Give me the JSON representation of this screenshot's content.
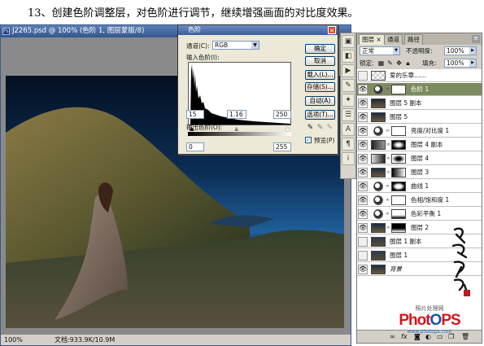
{
  "caption": "13、创建色阶调整层，对色阶进行调节，继续增强画面的对比度效果。",
  "document": {
    "title": "J2265.psd @ 100% (色阶 1, 图层蒙版/8)",
    "zoom": "100%",
    "file_info": "文档:933.9K/10.9M"
  },
  "levels_dialog": {
    "title": "色阶",
    "channel_label": "通道(C):",
    "channel_value": "RGB",
    "input_label": "输入色阶(I):",
    "input_black": "15",
    "input_gamma": "1.16",
    "input_white": "250",
    "output_label": "输出色阶(O):",
    "output_black": "0",
    "output_white": "255",
    "buttons": {
      "ok": "确定",
      "cancel": "取消",
      "load": "载入(L)...",
      "save": "存储(S)...",
      "auto": "自动(A)",
      "options": "选项(T)..."
    },
    "preview_label": "预览(P)",
    "preview_checked": true
  },
  "layers_panel": {
    "tabs": [
      "图层",
      "通道",
      "路径"
    ],
    "blend_mode": "正常",
    "opacity_label": "不透明度:",
    "opacity_value": "100%",
    "lock_label": "锁定:",
    "fill_label": "填充:",
    "fill_value": "100%",
    "layers": [
      {
        "name": "爱的乐章……",
        "type": "text",
        "visible": false
      },
      {
        "name": "色阶 1",
        "type": "adjustment",
        "visible": true,
        "selected": true
      },
      {
        "name": "图层 5 副本",
        "type": "pixel",
        "visible": true
      },
      {
        "name": "图层 5",
        "type": "pixel",
        "visible": true
      },
      {
        "name": "亮度/对比度 1",
        "type": "adjustment",
        "visible": true
      },
      {
        "name": "图层 4 副本",
        "type": "masked",
        "visible": true
      },
      {
        "name": "图层 4",
        "type": "masked",
        "visible": true
      },
      {
        "name": "图层 3",
        "type": "masked",
        "visible": true
      },
      {
        "name": "曲线 1",
        "type": "adjustment",
        "visible": true
      },
      {
        "name": "色相/饱和度 1",
        "type": "adjustment",
        "visible": true
      },
      {
        "name": "色彩平衡 1",
        "type": "adjustment",
        "visible": true
      },
      {
        "name": "图层 2",
        "type": "masked",
        "visible": true
      },
      {
        "name": "图层 1 副本",
        "type": "pixel",
        "visible": false
      },
      {
        "name": "图层 1",
        "type": "pixel",
        "visible": false
      },
      {
        "name": "背景",
        "type": "pixel",
        "visible": true
      }
    ],
    "footer_icons": [
      "link-icon",
      "fx-icon",
      "mask-icon",
      "adjustment-icon",
      "folder-icon",
      "new-layer-icon",
      "trash-icon"
    ]
  },
  "watermark": {
    "label": "照片处理网",
    "brand": "PhotoPS",
    "url": "www.photops.com"
  },
  "colors": {
    "titlebar": "#33568e",
    "selected_layer": "#7d8c5f",
    "brand_red": "#d4161b",
    "brand_blue": "#1b4fb0"
  }
}
